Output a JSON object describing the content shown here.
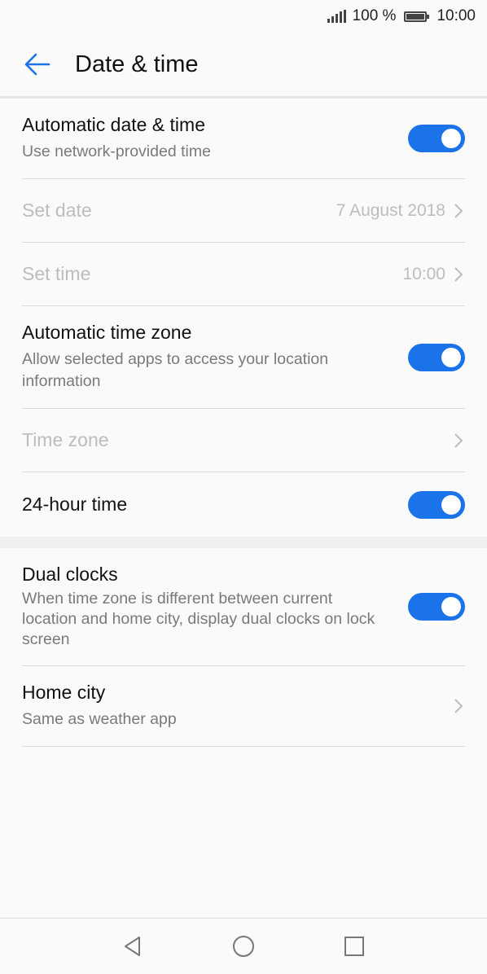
{
  "status_bar": {
    "battery_percent": "100 %",
    "time": "10:00"
  },
  "app_bar": {
    "title": "Date & time"
  },
  "section1": {
    "auto_datetime": {
      "title": "Automatic date & time",
      "subtitle": "Use network-provided time",
      "enabled": true
    },
    "set_date": {
      "title": "Set date",
      "value": "7 August 2018"
    },
    "set_time": {
      "title": "Set time",
      "value": "10:00"
    },
    "auto_timezone": {
      "title": "Automatic time zone",
      "subtitle": "Allow selected apps to access your location information",
      "enabled": true
    },
    "time_zone": {
      "title": "Time zone"
    },
    "hour24": {
      "title": "24-hour time",
      "enabled": true
    }
  },
  "section2": {
    "dual_clocks": {
      "title": "Dual clocks",
      "subtitle": "When time zone is different between current location and home city, display dual clocks on lock screen",
      "enabled": true
    },
    "home_city": {
      "title": "Home city",
      "subtitle": "Same as weather app"
    }
  },
  "colors": {
    "accent": "#1a73e8",
    "disabled_text": "#bdbdbd",
    "secondary_text": "#7a7a7a"
  },
  "icons": [
    "signal-icon",
    "battery-icon",
    "back-arrow-icon",
    "chevron-right-icon",
    "nav-back-icon",
    "nav-home-icon",
    "nav-recents-icon"
  ]
}
